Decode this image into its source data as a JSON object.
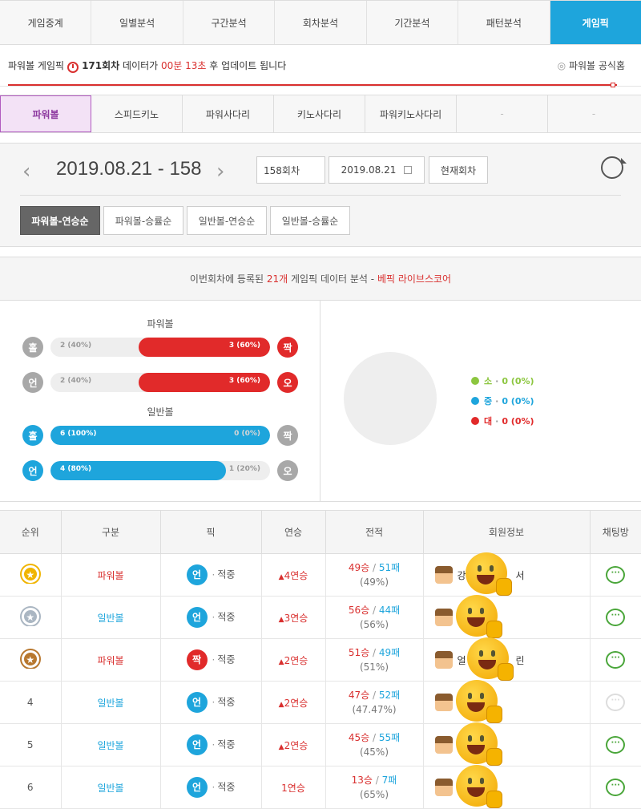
{
  "top_nav": [
    "게임중계",
    "일별분석",
    "구간분석",
    "회차분석",
    "기간분석",
    "패턴분석",
    "게임픽"
  ],
  "info_bar": {
    "prefix": "파워볼 게임픽",
    "round": "171회차",
    "middle": "데이터가",
    "countdown": "00분 13초",
    "suffix": "후 업데이트 됩니다",
    "official_label": "파워볼 공식홈"
  },
  "game_tabs": [
    "파워볼",
    "스피드키노",
    "파워사다리",
    "키노사다리",
    "파워키노사다리",
    "-",
    "-"
  ],
  "round_selector": {
    "title": "2019.08.21 - 158",
    "round_value": "158회차",
    "date_value": "2019.08.21",
    "current_button": "현재회차",
    "prev_arrow": "‹",
    "next_arrow": "›"
  },
  "sort_buttons": [
    "파워볼-연승순",
    "파워볼-승률순",
    "일반볼-연승순",
    "일반볼-승률순"
  ],
  "analysis": {
    "pre": "이번회차에 등록된",
    "count": "21개",
    "mid": "게임픽 데이터 분석 -",
    "source": "베픽 라이브스코어",
    "powerball_label": "파워볼",
    "normal_label": "일반볼",
    "rows": [
      {
        "left": "홀",
        "right": "짝",
        "left_text": "2 (40%)",
        "right_text": "3 (60%)",
        "left_frac": 0.4,
        "right_frac": 0.6,
        "winner": "right",
        "color": "#e12a2a"
      },
      {
        "left": "언",
        "right": "오",
        "left_text": "2 (40%)",
        "right_text": "3 (60%)",
        "left_frac": 0.4,
        "right_frac": 0.6,
        "winner": "right",
        "color": "#e12a2a"
      },
      {
        "left": "홀",
        "right": "짝",
        "left_text": "6 (100%)",
        "right_text": "0 (0%)",
        "left_frac": 1.0,
        "right_frac": 0.0,
        "winner": "left",
        "color": "#1ea5dc"
      },
      {
        "left": "언",
        "right": "오",
        "left_text": "4 (80%)",
        "right_text": "1 (20%)",
        "left_frac": 0.8,
        "right_frac": 0.2,
        "winner": "left",
        "color": "#1ea5dc"
      }
    ],
    "legend": [
      {
        "name": "소",
        "value": "0 (0%)",
        "color": "#8cc63f"
      },
      {
        "name": "중",
        "value": "0 (0%)",
        "color": "#1ea5dc"
      },
      {
        "name": "대",
        "value": "0 (0%)",
        "color": "#e12a2a"
      }
    ]
  },
  "table": {
    "headers": [
      "순위",
      "구분",
      "픽",
      "연승",
      "전적",
      "회원정보",
      "채팅방"
    ],
    "pick_result": "적중",
    "rows": [
      {
        "rank": "1",
        "medal": "gold",
        "category": "파워볼",
        "cat_color": "#d9302f",
        "pick": "언",
        "pick_color": "#1ea5dc",
        "streak": "4연승",
        "streak_up": true,
        "wins": "49승",
        "losses": "51패",
        "rate": "(49%)",
        "member_pre": "강",
        "member_post": "서",
        "chat_active": true
      },
      {
        "rank": "2",
        "medal": "silver",
        "category": "일반볼",
        "cat_color": "#1ea5dc",
        "pick": "언",
        "pick_color": "#1ea5dc",
        "streak": "3연승",
        "streak_up": true,
        "wins": "56승",
        "losses": "44패",
        "rate": "(56%)",
        "member_pre": "",
        "member_post": "",
        "chat_active": true
      },
      {
        "rank": "3",
        "medal": "bronze",
        "category": "파워볼",
        "cat_color": "#d9302f",
        "pick": "짝",
        "pick_color": "#e12a2a",
        "streak": "2연승",
        "streak_up": true,
        "wins": "51승",
        "losses": "49패",
        "rate": "(51%)",
        "member_pre": "얼",
        "member_post": "린",
        "chat_active": true
      },
      {
        "rank": "4",
        "medal": "",
        "category": "일반볼",
        "cat_color": "#1ea5dc",
        "pick": "언",
        "pick_color": "#1ea5dc",
        "streak": "2연승",
        "streak_up": true,
        "wins": "47승",
        "losses": "52패",
        "rate": "(47.47%)",
        "member_pre": "",
        "member_post": "",
        "chat_active": false
      },
      {
        "rank": "5",
        "medal": "",
        "category": "일반볼",
        "cat_color": "#1ea5dc",
        "pick": "언",
        "pick_color": "#1ea5dc",
        "streak": "2연승",
        "streak_up": true,
        "wins": "45승",
        "losses": "55패",
        "rate": "(45%)",
        "member_pre": "",
        "member_post": "",
        "chat_active": true
      },
      {
        "rank": "6",
        "medal": "",
        "category": "일반볼",
        "cat_color": "#1ea5dc",
        "pick": "언",
        "pick_color": "#1ea5dc",
        "streak": "1연승",
        "streak_up": false,
        "wins": "13승",
        "losses": "7패",
        "rate": "(65%)",
        "member_pre": "",
        "member_post": "",
        "chat_active": true
      }
    ]
  },
  "colors": {
    "accent": "#1ea5dc",
    "red": "#d9302f",
    "purple": "#8e3aa0",
    "green": "#4aa63a"
  }
}
